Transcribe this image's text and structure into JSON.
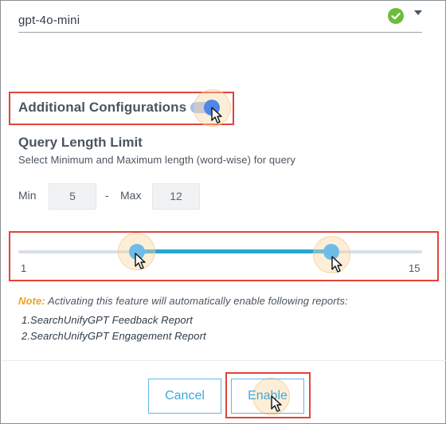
{
  "model_select": {
    "value": "gpt-4o-mini",
    "status_icon": "check-circle-icon",
    "dropdown_icon": "caret-down-icon",
    "status_color": "#6cbd3c"
  },
  "additional_configurations": {
    "label": "Additional Configurations",
    "toggle_on": true,
    "toggle_color": "#4f86ea"
  },
  "query_length_limit": {
    "title": "Query Length Limit",
    "description": "Select Minimum and Maximum length (word-wise) for query",
    "min_label": "Min",
    "min_value": "5",
    "separator": "-",
    "max_label": "Max",
    "max_value": "12",
    "slider": {
      "range_min": "1",
      "range_max": "15",
      "selected_min": 5,
      "selected_max": 12,
      "accent_color": "#26a6d6"
    }
  },
  "note": {
    "label": "Note:",
    "text": " Activating this feature will automatically enable following reports:",
    "reports": [
      "1.SearchUnifyGPT Feedback Report",
      "2.SearchUnifyGPT Engagement Report"
    ]
  },
  "footer": {
    "cancel_label": "Cancel",
    "enable_label": "Enable"
  },
  "highlight_color": "#e0443a"
}
